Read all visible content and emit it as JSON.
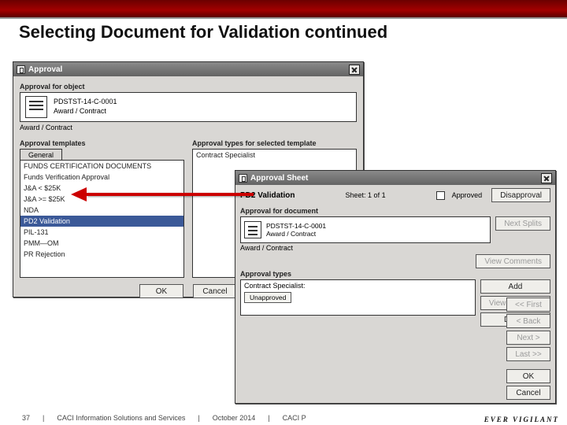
{
  "slide": {
    "title": "Selecting Document for Validation continued",
    "page": "37"
  },
  "footer": {
    "org": "CACI Information Solutions and Services",
    "date": "October 2014",
    "prop": "CACI P",
    "tagline": "EVER VIGILANT"
  },
  "approval_window": {
    "title": "Approval",
    "sections": {
      "for_object": "Approval for object",
      "templates": "Approval templates",
      "types": "Approval types for selected template"
    },
    "object": {
      "id": "PDSTST-14-C-0001",
      "desc": "Award / Contract"
    },
    "sidecaption": "Award / Contract",
    "tab_general": "General",
    "templates": [
      "FUNDS CERTIFICATION DOCUMENTS",
      "Funds Verification Approval",
      "J&A < $25K",
      "J&A >= $25K",
      "NDA",
      "PD2 Validation",
      "PIL-131",
      "PMM—OM",
      "PR Rejection"
    ],
    "template_selected_index": 5,
    "types": [
      "Contract Specialist"
    ],
    "buttons": {
      "ok": "OK",
      "cancel": "Cancel"
    }
  },
  "sheet_window": {
    "title": "Approval Sheet",
    "header_name": "PD2 Validation",
    "sheet_text": "Sheet: 1 of 1",
    "approved_label": "Approved",
    "sections": {
      "for_document": "Approval for document",
      "types": "Approval types"
    },
    "object": {
      "id": "PDSTST-14-C-0001",
      "desc": "Award / Contract"
    },
    "sidecaption": "Award / Contract",
    "row_label": "Contract Specialist:",
    "row_value": "Unapproved",
    "buttons": {
      "disapproval": "Disapproval",
      "next_splits": "Next Splits",
      "view_comments": "View Comments",
      "add": "Add",
      "view_signature": "View Signature",
      "delete": "Delete",
      "first": "<< First",
      "back": "< Back",
      "next": "Next >",
      "last": "Last >>",
      "ok": "OK",
      "cancel": "Cancel"
    }
  }
}
